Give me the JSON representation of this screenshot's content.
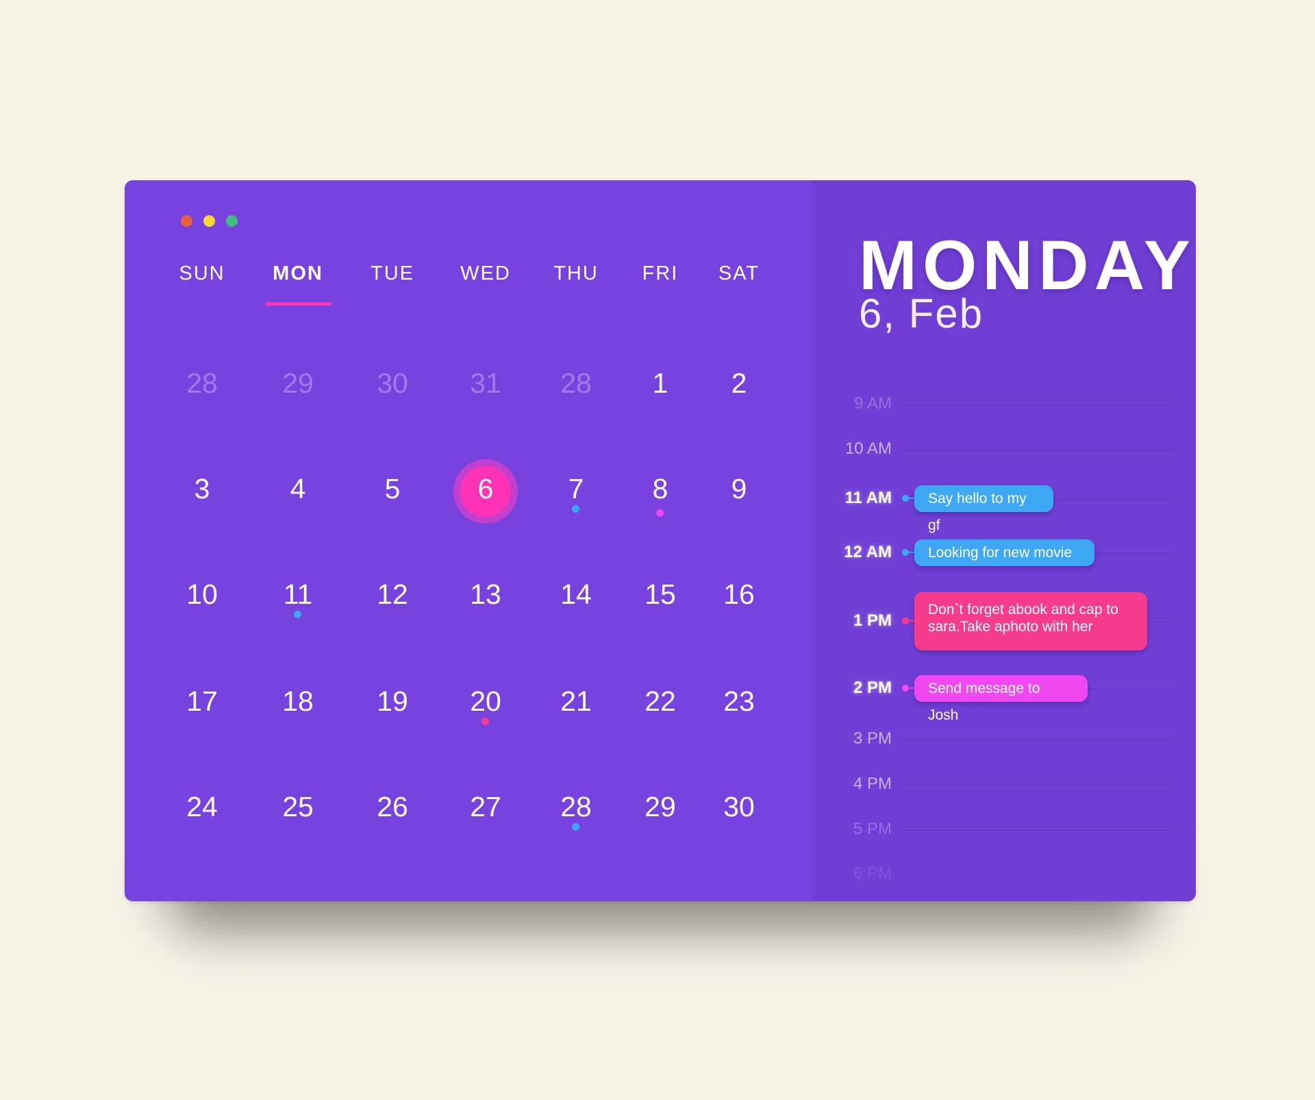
{
  "window_controls": [
    {
      "name": "close",
      "color": "#E8603F"
    },
    {
      "name": "minimize",
      "color": "#FDD731"
    },
    {
      "name": "maximize",
      "color": "#3DBE7E"
    }
  ],
  "weekdays": [
    "SUN",
    "MON",
    "TUE",
    "WED",
    "THU",
    "FRI",
    "SAT"
  ],
  "active_weekday": "MON",
  "dates": [
    [
      {
        "d": "28",
        "muted": true
      },
      {
        "d": "29",
        "muted": true
      },
      {
        "d": "30",
        "muted": true
      },
      {
        "d": "31",
        "muted": true
      },
      {
        "d": "28",
        "muted": true
      },
      {
        "d": "1"
      },
      {
        "d": "2"
      }
    ],
    [
      {
        "d": "3"
      },
      {
        "d": "4"
      },
      {
        "d": "5"
      },
      {
        "d": "6",
        "today": true
      },
      {
        "d": "7",
        "dot": "#3FA8F5"
      },
      {
        "d": "8",
        "dot": "#F049F2"
      },
      {
        "d": "9"
      }
    ],
    [
      {
        "d": "10"
      },
      {
        "d": "11",
        "dot": "#3FA8F5"
      },
      {
        "d": "12"
      },
      {
        "d": "13"
      },
      {
        "d": "14"
      },
      {
        "d": "15"
      },
      {
        "d": "16"
      }
    ],
    [
      {
        "d": "17"
      },
      {
        "d": "18"
      },
      {
        "d": "19"
      },
      {
        "d": "20",
        "dot": "#F63C8D"
      },
      {
        "d": "21"
      },
      {
        "d": "22"
      },
      {
        "d": "23"
      }
    ],
    [
      {
        "d": "24"
      },
      {
        "d": "25"
      },
      {
        "d": "26"
      },
      {
        "d": "27"
      },
      {
        "d": "28",
        "dot": "#3FA8F5"
      },
      {
        "d": "29"
      },
      {
        "d": "30"
      }
    ]
  ],
  "day_panel": {
    "title": "MONDAY",
    "subtitle": "6, Feb"
  },
  "timeline": [
    {
      "time": "9 AM",
      "style": "faint-soft"
    },
    {
      "time": "10 AM",
      "style": "normal"
    },
    {
      "time": "11 AM",
      "style": "strong",
      "event": "Say hello to my gf",
      "color": "#3FA8F5"
    },
    {
      "time": "12 AM",
      "style": "strong",
      "event": "Looking for new movie",
      "color": "#3FA8F5"
    },
    {
      "time": "1 PM",
      "style": "strong",
      "event": "Don`t forget abook and cap to sara.Take aphoto with her",
      "color": "#F63C8D"
    },
    {
      "time": "2 PM",
      "style": "strong",
      "event": "Send message to Josh",
      "color": "#F049F2"
    },
    {
      "time": "3 PM",
      "style": "normal"
    },
    {
      "time": "4 PM",
      "style": "normal"
    },
    {
      "time": "5 PM",
      "style": "dim"
    },
    {
      "time": "6 PM",
      "style": "faint"
    }
  ],
  "colors": {
    "background": "#F6F4E7",
    "calendar_panel": "#7742DE",
    "day_panel": "#713FD5",
    "accent": "#FF33B5"
  }
}
